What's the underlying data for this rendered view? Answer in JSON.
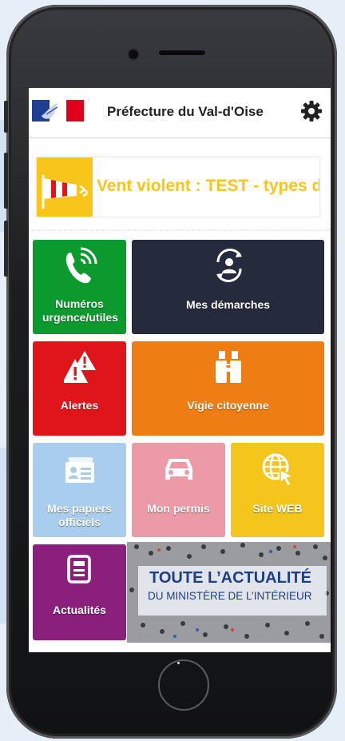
{
  "app": {
    "title": "Préfecture du Val-d'Oise"
  },
  "alert_banner": {
    "text": "Vent violent : TEST - types d"
  },
  "tiles": {
    "urgence": "Numéros urgence/utiles",
    "demarches": "Mes démarches",
    "alertes": "Alertes",
    "vigie": "Vigie citoyenne",
    "papiers": "Mes papiers officiels",
    "permis": "Mon permis",
    "site": "Site WEB",
    "actualites": "Actualités"
  },
  "news_banner": {
    "line1": "TOUTE L’ACTUALITÉ",
    "line2": "DU MINISTÈRE DE L’INTÉRIEUR"
  },
  "colors": {
    "green": "#0a9a2d",
    "navy": "#252a3d",
    "red": "#e0151b",
    "orange": "#ee7e14",
    "light_blue": "#a9cdec",
    "pink": "#ec9aa6",
    "yellow": "#f4c51a",
    "purple": "#8a1f7c"
  },
  "icons": [
    "marianne-flag-icon",
    "gear-icon",
    "windsock-icon",
    "phone-icon",
    "person-sync-icon",
    "warning-icon",
    "binoculars-icon",
    "id-card-icon",
    "car-icon",
    "globe-cursor-icon",
    "newspaper-icon"
  ]
}
